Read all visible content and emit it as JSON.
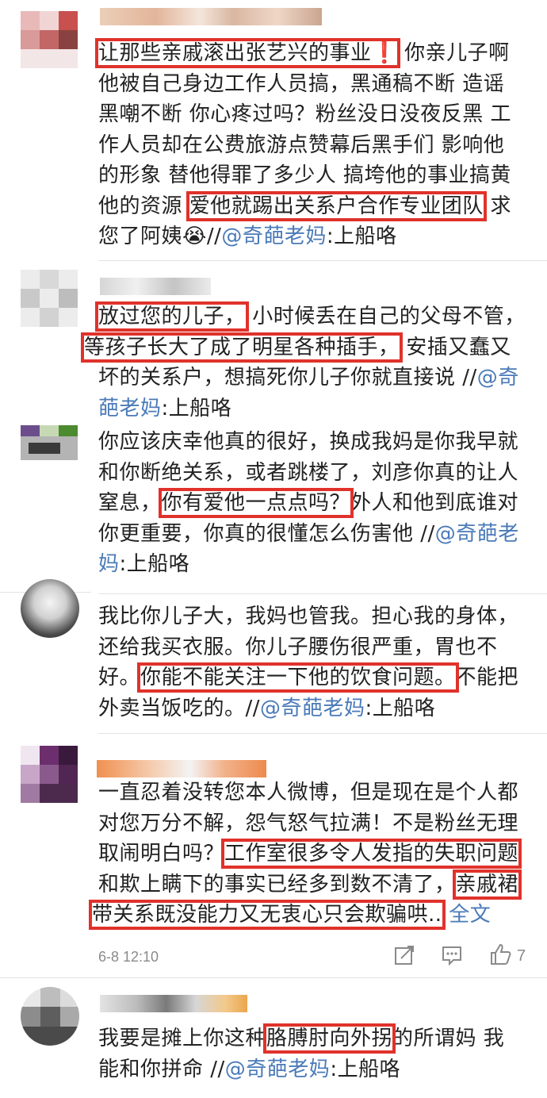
{
  "comments": [
    {
      "lines": [
        [
          "让那些亲戚滚出张艺兴的事业❗",
          "你亲儿子啊"
        ],
        [
          "他被自己身边工作人员搞，黑通稿不断 造谣"
        ],
        [
          "黑嘲不断 你心疼过吗？粉丝没日没夜反黑 工"
        ],
        [
          "作人员却在公费旅游点赞幕后黑手们 影响他"
        ],
        [
          "的形象 替他得罪了多少人 搞垮他的事业搞黄"
        ],
        [
          "他的资源 ",
          "爱他就踢出关系户合作专业团队",
          " 求"
        ],
        [
          "您了阿姨😭//",
          "@奇葩老妈",
          ":上船咯"
        ]
      ]
    },
    {
      "lines": [
        [
          "放过您的儿子，",
          " 小时候丢在自己的父母不管，"
        ],
        [
          "等孩子长大了成了明星各种插手，",
          " 安插又蠢又"
        ],
        [
          "坏的关系户，想搞死你儿子你就直接说 //",
          "@奇"
        ],
        [
          "葩老妈",
          ":上船咯"
        ]
      ]
    },
    {
      "lines": [
        [
          "你应该庆幸他真的很好，换成我妈是你我早就"
        ],
        [
          "和你断绝关系，或者跳楼了，刘彦你真的让人"
        ],
        [
          "窒息，",
          "你有爱他一点点吗？",
          "外人和他到底谁对"
        ],
        [
          "你更重要，你真的很懂怎么伤害他 //",
          "@奇葩老"
        ],
        [
          "妈",
          ":上船咯"
        ]
      ]
    },
    {
      "lines": [
        [
          "我比你儿子大，我妈也管我。担心我的身体，"
        ],
        [
          "还给我买衣服。你儿子腰伤很严重，胃也不"
        ],
        [
          "好。",
          "你能不能关注一下他的饮食问题。",
          "不能把"
        ],
        [
          "外卖当饭吃的。//",
          "@奇葩老妈",
          ":上船咯"
        ]
      ]
    },
    {
      "lines": [
        [
          "一直忍着没转您本人微博，但是现在是个人都"
        ],
        [
          "对您万分不解，怨气怒气拉满！不是粉丝无理"
        ],
        [
          "取闹明白吗？",
          "工作室很多令人发指的失职问题"
        ],
        [
          "和欺上瞒下的事实已经多到数不清了，",
          "亲戚裙"
        ],
        [
          "带关系既没能力又无衷心只会欺骗哄..",
          " 全文"
        ]
      ],
      "timestamp": "6-8 12:10",
      "like_count": "7"
    },
    {
      "lines": [
        [
          "我要是摊上你这种",
          "胳膊肘向外拐",
          "的所谓妈 我"
        ],
        [
          "能和你拼命 //",
          "@奇葩老妈",
          ":上船咯"
        ]
      ]
    }
  ],
  "icons": {
    "share": "share-icon",
    "comment": "comment-icon",
    "like": "thumbs-up-icon"
  },
  "colors": {
    "highlight": "#e0322b",
    "mention": "#4a7ab8",
    "meta": "#8a8a8a"
  }
}
